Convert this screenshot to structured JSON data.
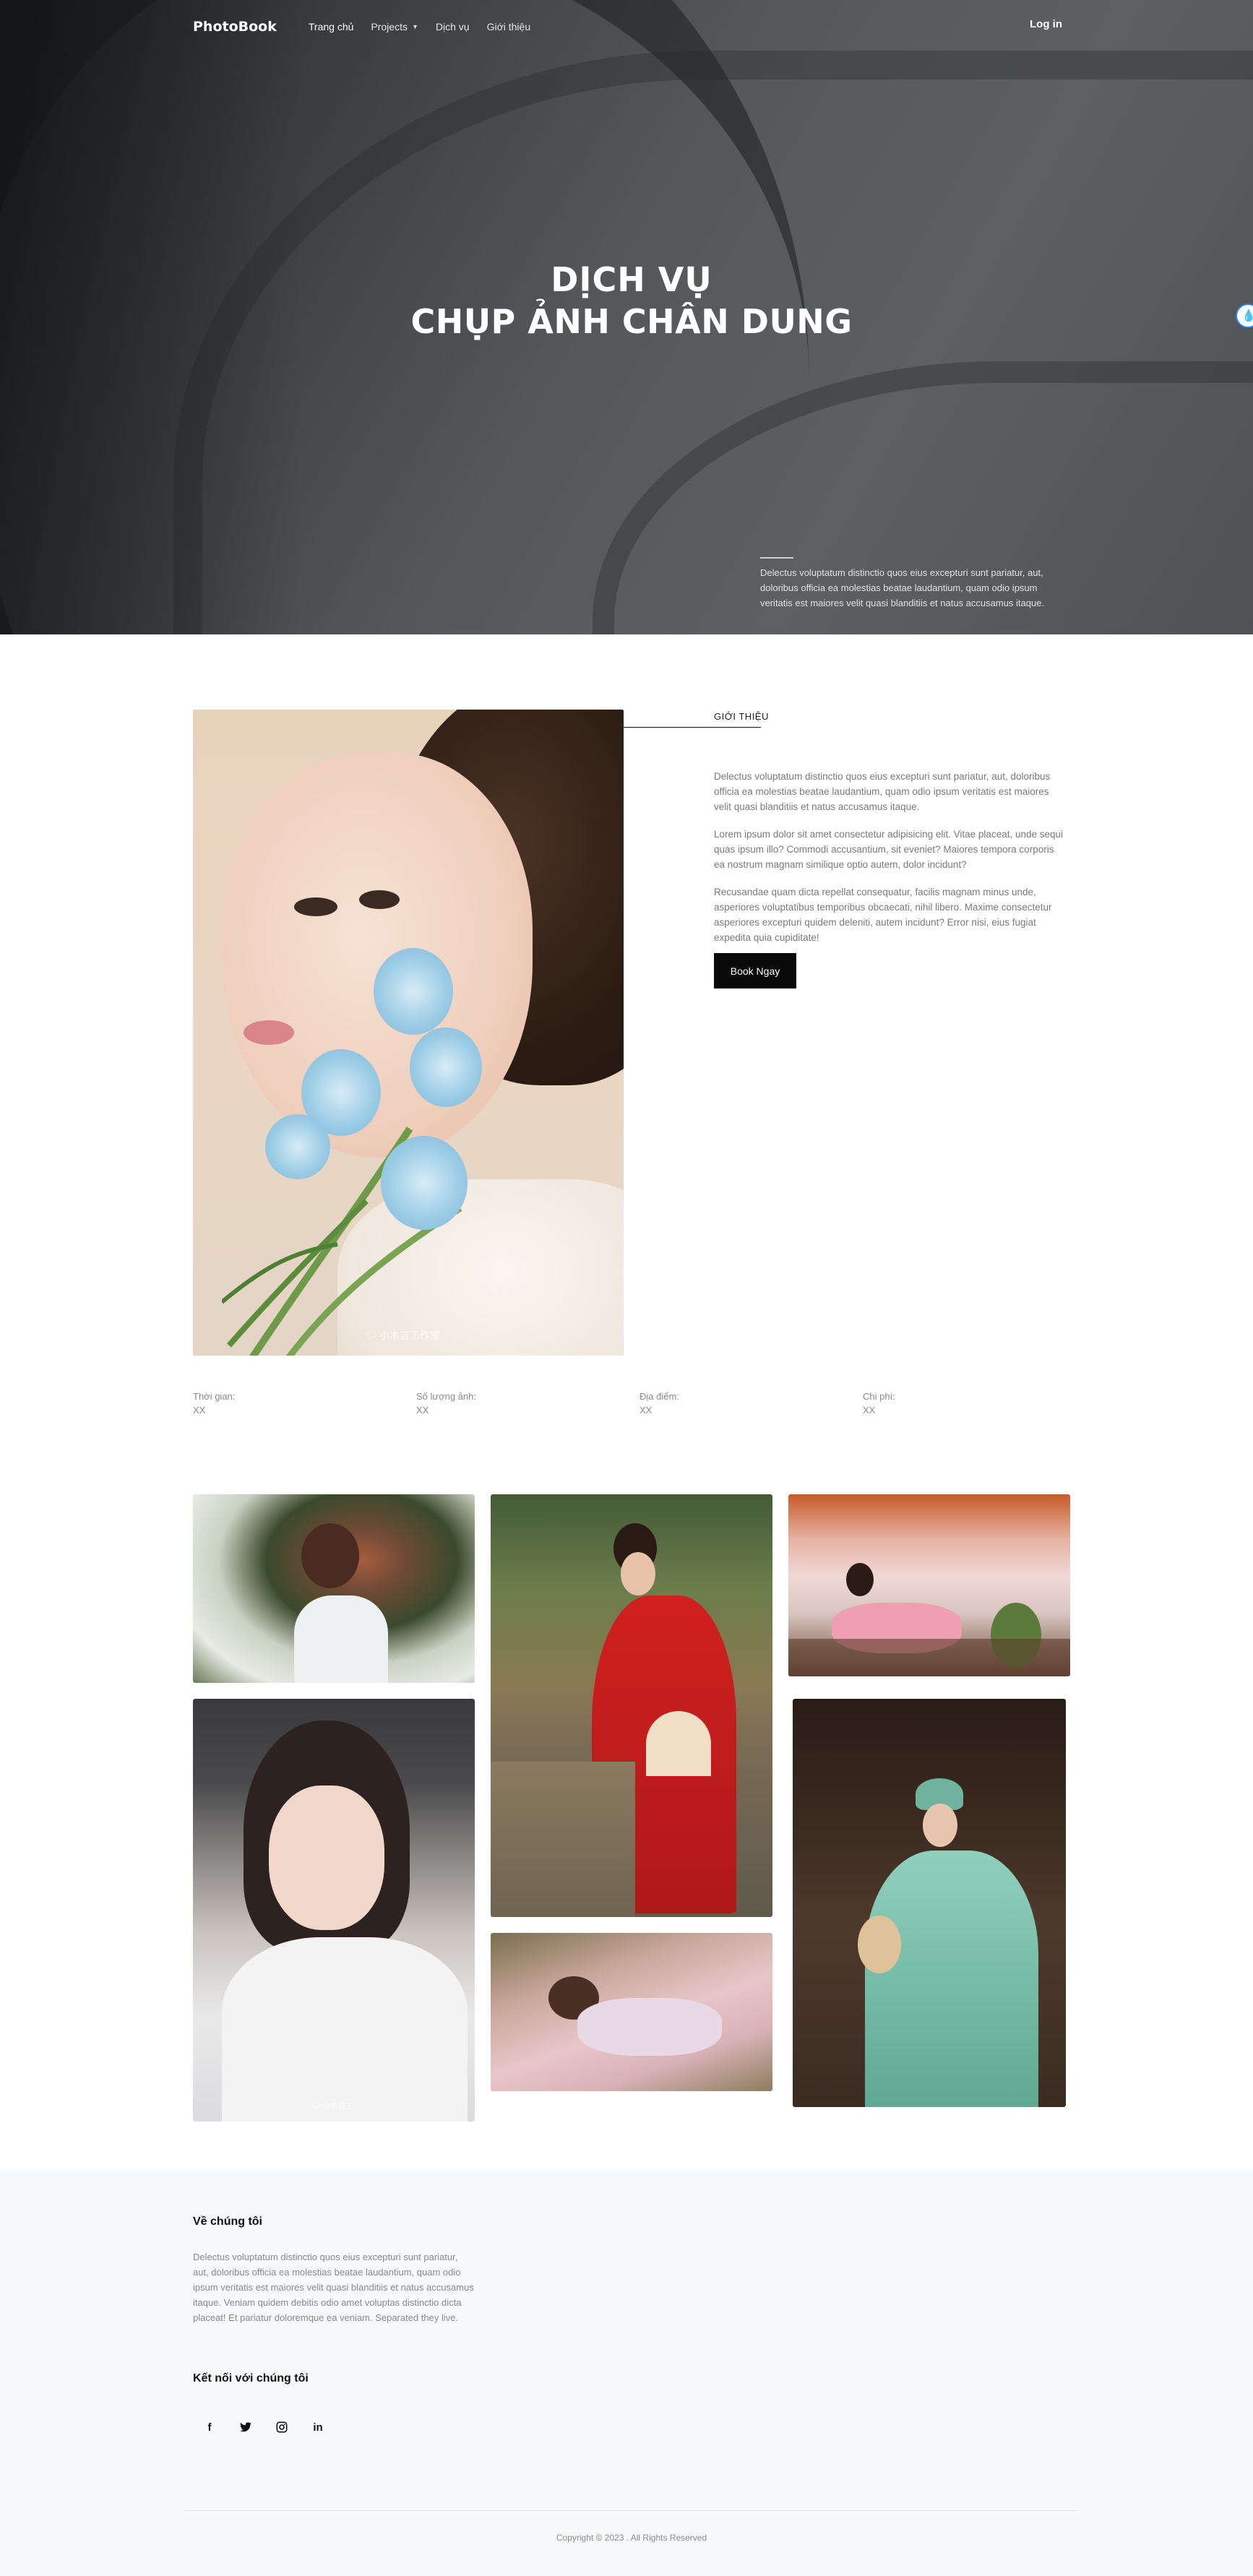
{
  "brand": {
    "logo": "PhotoBook"
  },
  "nav": {
    "items": [
      {
        "label": "Trang chủ"
      },
      {
        "label": "Projects"
      },
      {
        "label": "Dịch vụ"
      },
      {
        "label": "Giới thiệu"
      }
    ],
    "login": "Log in"
  },
  "hero": {
    "title_line1": "DỊCH VỤ",
    "title_line2": "CHỤP ẢNH CHÂN DUNG",
    "description": "Delectus voluptatum distinctio quos eius excepturi sunt pariatur, aut, doloribus officia ea molestias beatae laudantium, quam odio ipsum veritatis est maiores velit quasi blanditiis et natus accusamus itaque."
  },
  "intro": {
    "label": "GIỚI THIỆU",
    "paragraphs": [
      "Delectus voluptatum distinctio quos eius excepturi sunt pariatur, aut, doloribus officia ea molestias beatae laudantium, quam odio ipsum veritatis est maiores velit quasi blanditiis et natus accusamus itaque.",
      "Lorem ipsum dolor sit amet consectetur adipisicing elit. Vitae placeat, unde sequi quas ipsum illo? Commodi accusantium, sit eveniet? Maiores tempora corporis ea nostrum magnam similique optio autem, dolor incidunt?",
      "Recusandae quam dicta repellat consequatur, facilis magnam minus unde, asperiores voluptatibus temporibus obcaecati, nihil libero. Maxime consectetur asperiores excepturi quidem deleniti, autem incidunt? Error nisi, eius fugiat expedita quia cupiditate!"
    ],
    "button": "Book Ngay",
    "portrait_watermark": "◎ 小木吉工作室"
  },
  "details": [
    {
      "label": "Thời gian:",
      "value": "XX"
    },
    {
      "label": "Số lượng ảnh:",
      "value": "XX"
    },
    {
      "label": "Địa điểm:",
      "value": "XX"
    },
    {
      "label": "Chi phí:",
      "value": "XX"
    }
  ],
  "gallery": {
    "watermark": "◎ 小木吉工"
  },
  "footer": {
    "about_title": "Về chúng tôi",
    "about_text": "Delectus voluptatum distinctio quos eius excepturi sunt pariatur, aut, doloribus officia ea molestias beatae laudantium, quam odio ipsum veritatis est maiores velit quasi blanditiis et natus accusamus itaque. Veniam quidem debitis odio amet voluptas distinctio dicta placeat! Et pariatur doloremque ea veniam. Separated they live.",
    "connect_title": "Kết nối với chúng tôi",
    "socials": [
      {
        "icon": "facebook-icon",
        "glyph": "f"
      },
      {
        "icon": "twitter-icon",
        "glyph": "🐦"
      },
      {
        "icon": "instagram-icon",
        "glyph": "◎"
      },
      {
        "icon": "linkedin-icon",
        "glyph": "in"
      }
    ],
    "copyright": "Copyright © 2023 . All Rights Reserved"
  }
}
